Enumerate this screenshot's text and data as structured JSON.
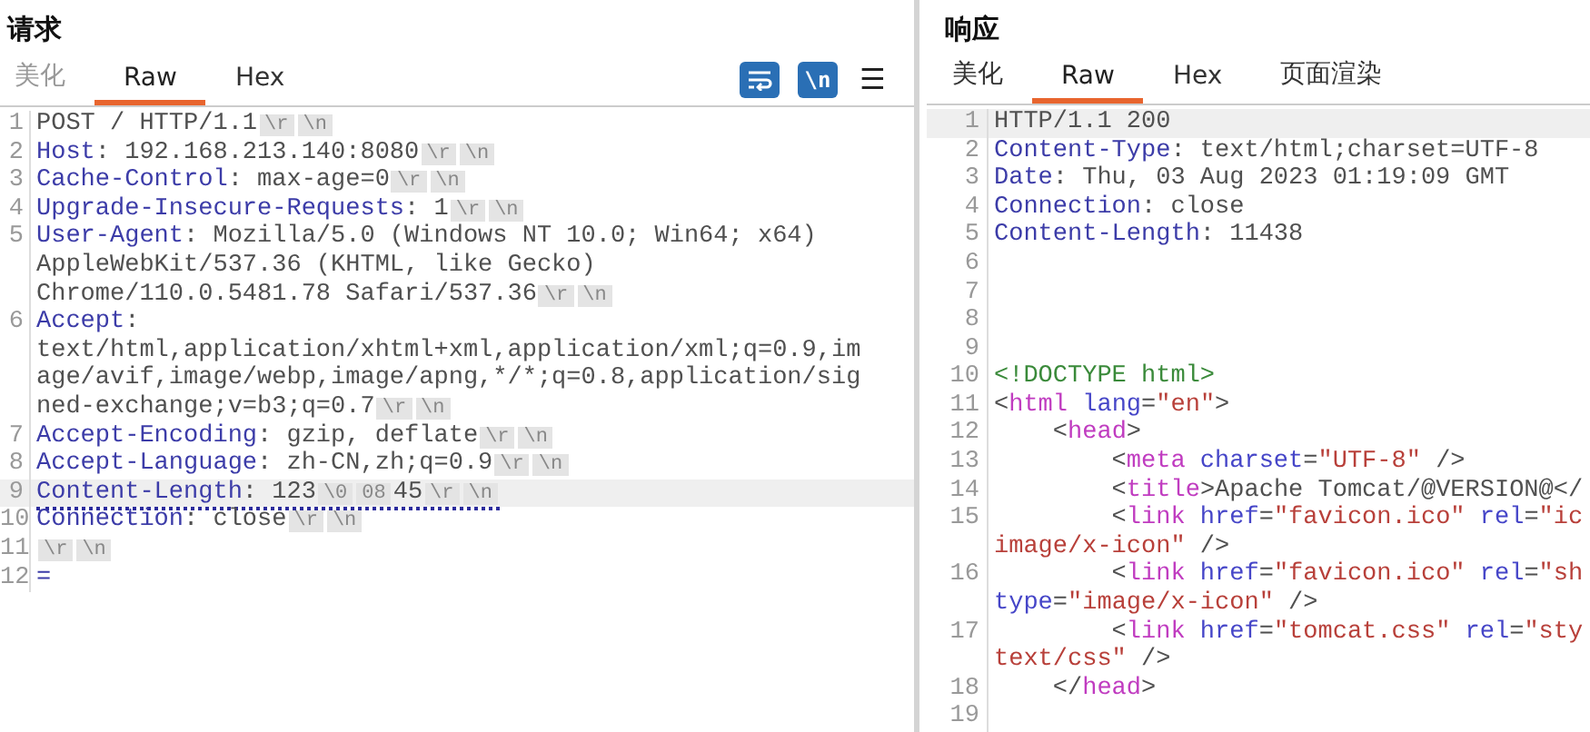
{
  "request": {
    "title": "请求",
    "tabs": [
      {
        "label": "美化",
        "selected": false,
        "disabled": true
      },
      {
        "label": "Raw",
        "selected": true,
        "disabled": false
      },
      {
        "label": "Hex",
        "selected": false,
        "disabled": false
      }
    ],
    "toolbar": [
      {
        "kind": "wrap",
        "on": true
      },
      {
        "kind": "newline",
        "label": "\\n",
        "on": true
      },
      {
        "kind": "menu",
        "label": "☰"
      }
    ],
    "lines": [
      {
        "num": "1",
        "highlighted": false,
        "flagged": false,
        "rows": [
          {
            "segments": [
              {
                "kind": "text",
                "text": "POST / HTTP/1.1"
              },
              {
                "kind": "chip",
                "text": "\\r"
              },
              {
                "kind": "chip",
                "text": "\\n"
              }
            ]
          }
        ]
      },
      {
        "num": "2",
        "highlighted": false,
        "flagged": false,
        "rows": [
          {
            "segments": [
              {
                "kind": "name",
                "text": "Host"
              },
              {
                "kind": "text",
                "text": ": 192.168.213.140:8080"
              },
              {
                "kind": "chip",
                "text": "\\r"
              },
              {
                "kind": "chip",
                "text": "\\n"
              }
            ]
          }
        ]
      },
      {
        "num": "3",
        "highlighted": false,
        "flagged": false,
        "rows": [
          {
            "segments": [
              {
                "kind": "name",
                "text": "Cache-Control"
              },
              {
                "kind": "text",
                "text": ": max-age=0"
              },
              {
                "kind": "chip",
                "text": "\\r"
              },
              {
                "kind": "chip",
                "text": "\\n"
              }
            ]
          }
        ]
      },
      {
        "num": "4",
        "highlighted": false,
        "flagged": false,
        "rows": [
          {
            "segments": [
              {
                "kind": "name",
                "text": "Upgrade-Insecure-Requests"
              },
              {
                "kind": "text",
                "text": ": 1"
              },
              {
                "kind": "chip",
                "text": "\\r"
              },
              {
                "kind": "chip",
                "text": "\\n"
              }
            ]
          }
        ]
      },
      {
        "num": "5",
        "highlighted": false,
        "flagged": false,
        "rows": [
          {
            "segments": [
              {
                "kind": "name",
                "text": "User-Agent"
              },
              {
                "kind": "text",
                "text": ": Mozilla/5.0 (Windows NT 10.0; Win64; x64)"
              }
            ]
          },
          {
            "segments": [
              {
                "kind": "text",
                "text": "AppleWebKit/537.36 (KHTML, like Gecko)"
              }
            ]
          },
          {
            "segments": [
              {
                "kind": "text",
                "text": "Chrome/110.0.5481.78 Safari/537.36"
              },
              {
                "kind": "chip",
                "text": "\\r"
              },
              {
                "kind": "chip",
                "text": "\\n"
              }
            ]
          }
        ]
      },
      {
        "num": "6",
        "highlighted": false,
        "flagged": false,
        "rows": [
          {
            "segments": [
              {
                "kind": "name",
                "text": "Accept"
              },
              {
                "kind": "text",
                "text": ":"
              }
            ]
          },
          {
            "segments": [
              {
                "kind": "text",
                "text": "text/html,application/xhtml+xml,application/xml;q=0.9,im"
              }
            ]
          },
          {
            "segments": [
              {
                "kind": "text",
                "text": "age/avif,image/webp,image/apng,*/*;q=0.8,application/sig"
              }
            ]
          },
          {
            "segments": [
              {
                "kind": "text",
                "text": "ned-exchange;v=b3;q=0.7"
              },
              {
                "kind": "chip",
                "text": "\\r"
              },
              {
                "kind": "chip",
                "text": "\\n"
              }
            ]
          }
        ]
      },
      {
        "num": "7",
        "highlighted": false,
        "flagged": false,
        "rows": [
          {
            "segments": [
              {
                "kind": "name",
                "text": "Accept-Encoding"
              },
              {
                "kind": "text",
                "text": ": gzip, deflate"
              },
              {
                "kind": "chip",
                "text": "\\r"
              },
              {
                "kind": "chip",
                "text": "\\n"
              }
            ]
          }
        ]
      },
      {
        "num": "8",
        "highlighted": false,
        "flagged": false,
        "rows": [
          {
            "segments": [
              {
                "kind": "name",
                "text": "Accept-Language"
              },
              {
                "kind": "text",
                "text": ": zh-CN,zh;q=0.9"
              },
              {
                "kind": "chip",
                "text": "\\r"
              },
              {
                "kind": "chip",
                "text": "\\n"
              }
            ]
          }
        ]
      },
      {
        "num": "9",
        "highlighted": true,
        "flagged": true,
        "rows": [
          {
            "segments": [
              {
                "kind": "name",
                "text": "Content-Length"
              },
              {
                "kind": "text",
                "text": ": 123"
              },
              {
                "kind": "chip",
                "text": "\\0"
              },
              {
                "kind": "chip",
                "text": "08"
              },
              {
                "kind": "text",
                "text": "45"
              },
              {
                "kind": "chip",
                "text": "\\r"
              },
              {
                "kind": "chip",
                "text": "\\n"
              }
            ]
          }
        ]
      },
      {
        "num": "10",
        "highlighted": false,
        "flagged": false,
        "rows": [
          {
            "segments": [
              {
                "kind": "name",
                "text": "Connection"
              },
              {
                "kind": "text",
                "text": ": close"
              },
              {
                "kind": "chip",
                "text": "\\r"
              },
              {
                "kind": "chip",
                "text": "\\n"
              }
            ]
          }
        ]
      },
      {
        "num": "11",
        "highlighted": false,
        "flagged": false,
        "rows": [
          {
            "segments": [
              {
                "kind": "chip",
                "text": "\\r"
              },
              {
                "kind": "chip",
                "text": "\\n"
              }
            ]
          }
        ]
      },
      {
        "num": "12",
        "highlighted": false,
        "flagged": false,
        "rows": [
          {
            "segments": [
              {
                "kind": "name",
                "text": "="
              }
            ]
          }
        ]
      }
    ]
  },
  "response": {
    "title": "响应",
    "tabs": [
      {
        "label": "美化",
        "selected": false,
        "disabled": false
      },
      {
        "label": "Raw",
        "selected": true,
        "disabled": false
      },
      {
        "label": "Hex",
        "selected": false,
        "disabled": false
      },
      {
        "label": "页面渲染",
        "selected": false,
        "disabled": false
      }
    ],
    "lines": [
      {
        "num": "1",
        "highlighted": true,
        "flagged": false,
        "rows": [
          {
            "segments": [
              {
                "kind": "text",
                "text": "HTTP/1.1 200"
              }
            ]
          }
        ]
      },
      {
        "num": "2",
        "highlighted": false,
        "flagged": false,
        "rows": [
          {
            "segments": [
              {
                "kind": "name",
                "text": "Content-Type"
              },
              {
                "kind": "text",
                "text": ": text/html;charset=UTF-8"
              }
            ]
          }
        ]
      },
      {
        "num": "3",
        "highlighted": false,
        "flagged": false,
        "rows": [
          {
            "segments": [
              {
                "kind": "name",
                "text": "Date"
              },
              {
                "kind": "text",
                "text": ": Thu, 03 Aug 2023 01:19:09 GMT"
              }
            ]
          }
        ]
      },
      {
        "num": "4",
        "highlighted": false,
        "flagged": false,
        "rows": [
          {
            "segments": [
              {
                "kind": "name",
                "text": "Connection"
              },
              {
                "kind": "text",
                "text": ": close"
              }
            ]
          }
        ]
      },
      {
        "num": "5",
        "highlighted": false,
        "flagged": false,
        "rows": [
          {
            "segments": [
              {
                "kind": "name",
                "text": "Content-Length"
              },
              {
                "kind": "text",
                "text": ": 11438"
              }
            ]
          }
        ]
      },
      {
        "num": "6",
        "highlighted": false,
        "flagged": false
      },
      {
        "num": "7",
        "highlighted": false,
        "flagged": false
      },
      {
        "num": "8",
        "highlighted": false,
        "flagged": false
      },
      {
        "num": "9",
        "highlighted": false,
        "flagged": false
      },
      {
        "num": "10",
        "highlighted": false,
        "flagged": false,
        "rows": [
          {
            "segments": [
              {
                "kind": "doctype",
                "text": "<!DOCTYPE html>"
              }
            ]
          }
        ]
      },
      {
        "num": "11",
        "highlighted": false,
        "flagged": false,
        "rows": [
          {
            "segments": [
              {
                "kind": "punct",
                "text": "<"
              },
              {
                "kind": "tag",
                "text": "html"
              },
              {
                "kind": "attr",
                "text": " lang"
              },
              {
                "kind": "punct",
                "text": "="
              },
              {
                "kind": "value",
                "text": "\"en\""
              },
              {
                "kind": "punct",
                "text": ">"
              }
            ]
          }
        ]
      },
      {
        "num": "12",
        "highlighted": false,
        "flagged": false,
        "rows": [
          {
            "segments": [
              {
                "kind": "punct",
                "text": "    <"
              },
              {
                "kind": "tag",
                "text": "head"
              },
              {
                "kind": "punct",
                "text": ">"
              }
            ]
          }
        ]
      },
      {
        "num": "13",
        "highlighted": false,
        "flagged": false,
        "rows": [
          {
            "segments": [
              {
                "kind": "punct",
                "text": "        <"
              },
              {
                "kind": "tag",
                "text": "meta"
              },
              {
                "kind": "attr",
                "text": " charset"
              },
              {
                "kind": "punct",
                "text": "="
              },
              {
                "kind": "value",
                "text": "\"UTF-8\""
              },
              {
                "kind": "punct",
                "text": " />"
              }
            ]
          }
        ]
      },
      {
        "num": "14",
        "highlighted": false,
        "flagged": false,
        "rows": [
          {
            "segments": [
              {
                "kind": "punct",
                "text": "        <"
              },
              {
                "kind": "tag",
                "text": "title"
              },
              {
                "kind": "punct",
                "text": ">"
              },
              {
                "kind": "text",
                "text": "Apache Tomcat/@VERSION@"
              },
              {
                "kind": "punct",
                "text": "</"
              }
            ]
          }
        ]
      },
      {
        "num": "15",
        "highlighted": false,
        "flagged": false,
        "rows": [
          {
            "segments": [
              {
                "kind": "punct",
                "text": "        <"
              },
              {
                "kind": "tag",
                "text": "link"
              },
              {
                "kind": "attr",
                "text": " href"
              },
              {
                "kind": "punct",
                "text": "="
              },
              {
                "kind": "value",
                "text": "\"favicon.ico\""
              },
              {
                "kind": "attr",
                "text": " rel"
              },
              {
                "kind": "punct",
                "text": "="
              },
              {
                "kind": "value",
                "text": "\"ic"
              }
            ]
          },
          {
            "segments": [
              {
                "kind": "value",
                "text": "image/x-icon\""
              },
              {
                "kind": "punct",
                "text": " />"
              }
            ]
          }
        ]
      },
      {
        "num": "16",
        "highlighted": false,
        "flagged": false,
        "rows": [
          {
            "segments": [
              {
                "kind": "punct",
                "text": "        <"
              },
              {
                "kind": "tag",
                "text": "link"
              },
              {
                "kind": "attr",
                "text": " href"
              },
              {
                "kind": "punct",
                "text": "="
              },
              {
                "kind": "value",
                "text": "\"favicon.ico\""
              },
              {
                "kind": "attr",
                "text": " rel"
              },
              {
                "kind": "punct",
                "text": "="
              },
              {
                "kind": "value",
                "text": "\"sh"
              }
            ]
          },
          {
            "segments": [
              {
                "kind": "attr",
                "text": "type"
              },
              {
                "kind": "punct",
                "text": "="
              },
              {
                "kind": "value",
                "text": "\"image/x-icon\""
              },
              {
                "kind": "punct",
                "text": " />"
              }
            ]
          }
        ]
      },
      {
        "num": "17",
        "highlighted": false,
        "flagged": false,
        "rows": [
          {
            "segments": [
              {
                "kind": "punct",
                "text": "        <"
              },
              {
                "kind": "tag",
                "text": "link"
              },
              {
                "kind": "attr",
                "text": " href"
              },
              {
                "kind": "punct",
                "text": "="
              },
              {
                "kind": "value",
                "text": "\"tomcat.css\""
              },
              {
                "kind": "attr",
                "text": " rel"
              },
              {
                "kind": "punct",
                "text": "="
              },
              {
                "kind": "value",
                "text": "\"sty"
              }
            ]
          },
          {
            "segments": [
              {
                "kind": "value",
                "text": "text/css\""
              },
              {
                "kind": "punct",
                "text": " />"
              }
            ]
          }
        ]
      },
      {
        "num": "18",
        "highlighted": false,
        "flagged": false,
        "rows": [
          {
            "segments": [
              {
                "kind": "punct",
                "text": "    </"
              },
              {
                "kind": "tag",
                "text": "head"
              },
              {
                "kind": "punct",
                "text": ">"
              }
            ]
          }
        ]
      },
      {
        "num": "19",
        "highlighted": false,
        "flagged": false
      }
    ]
  }
}
